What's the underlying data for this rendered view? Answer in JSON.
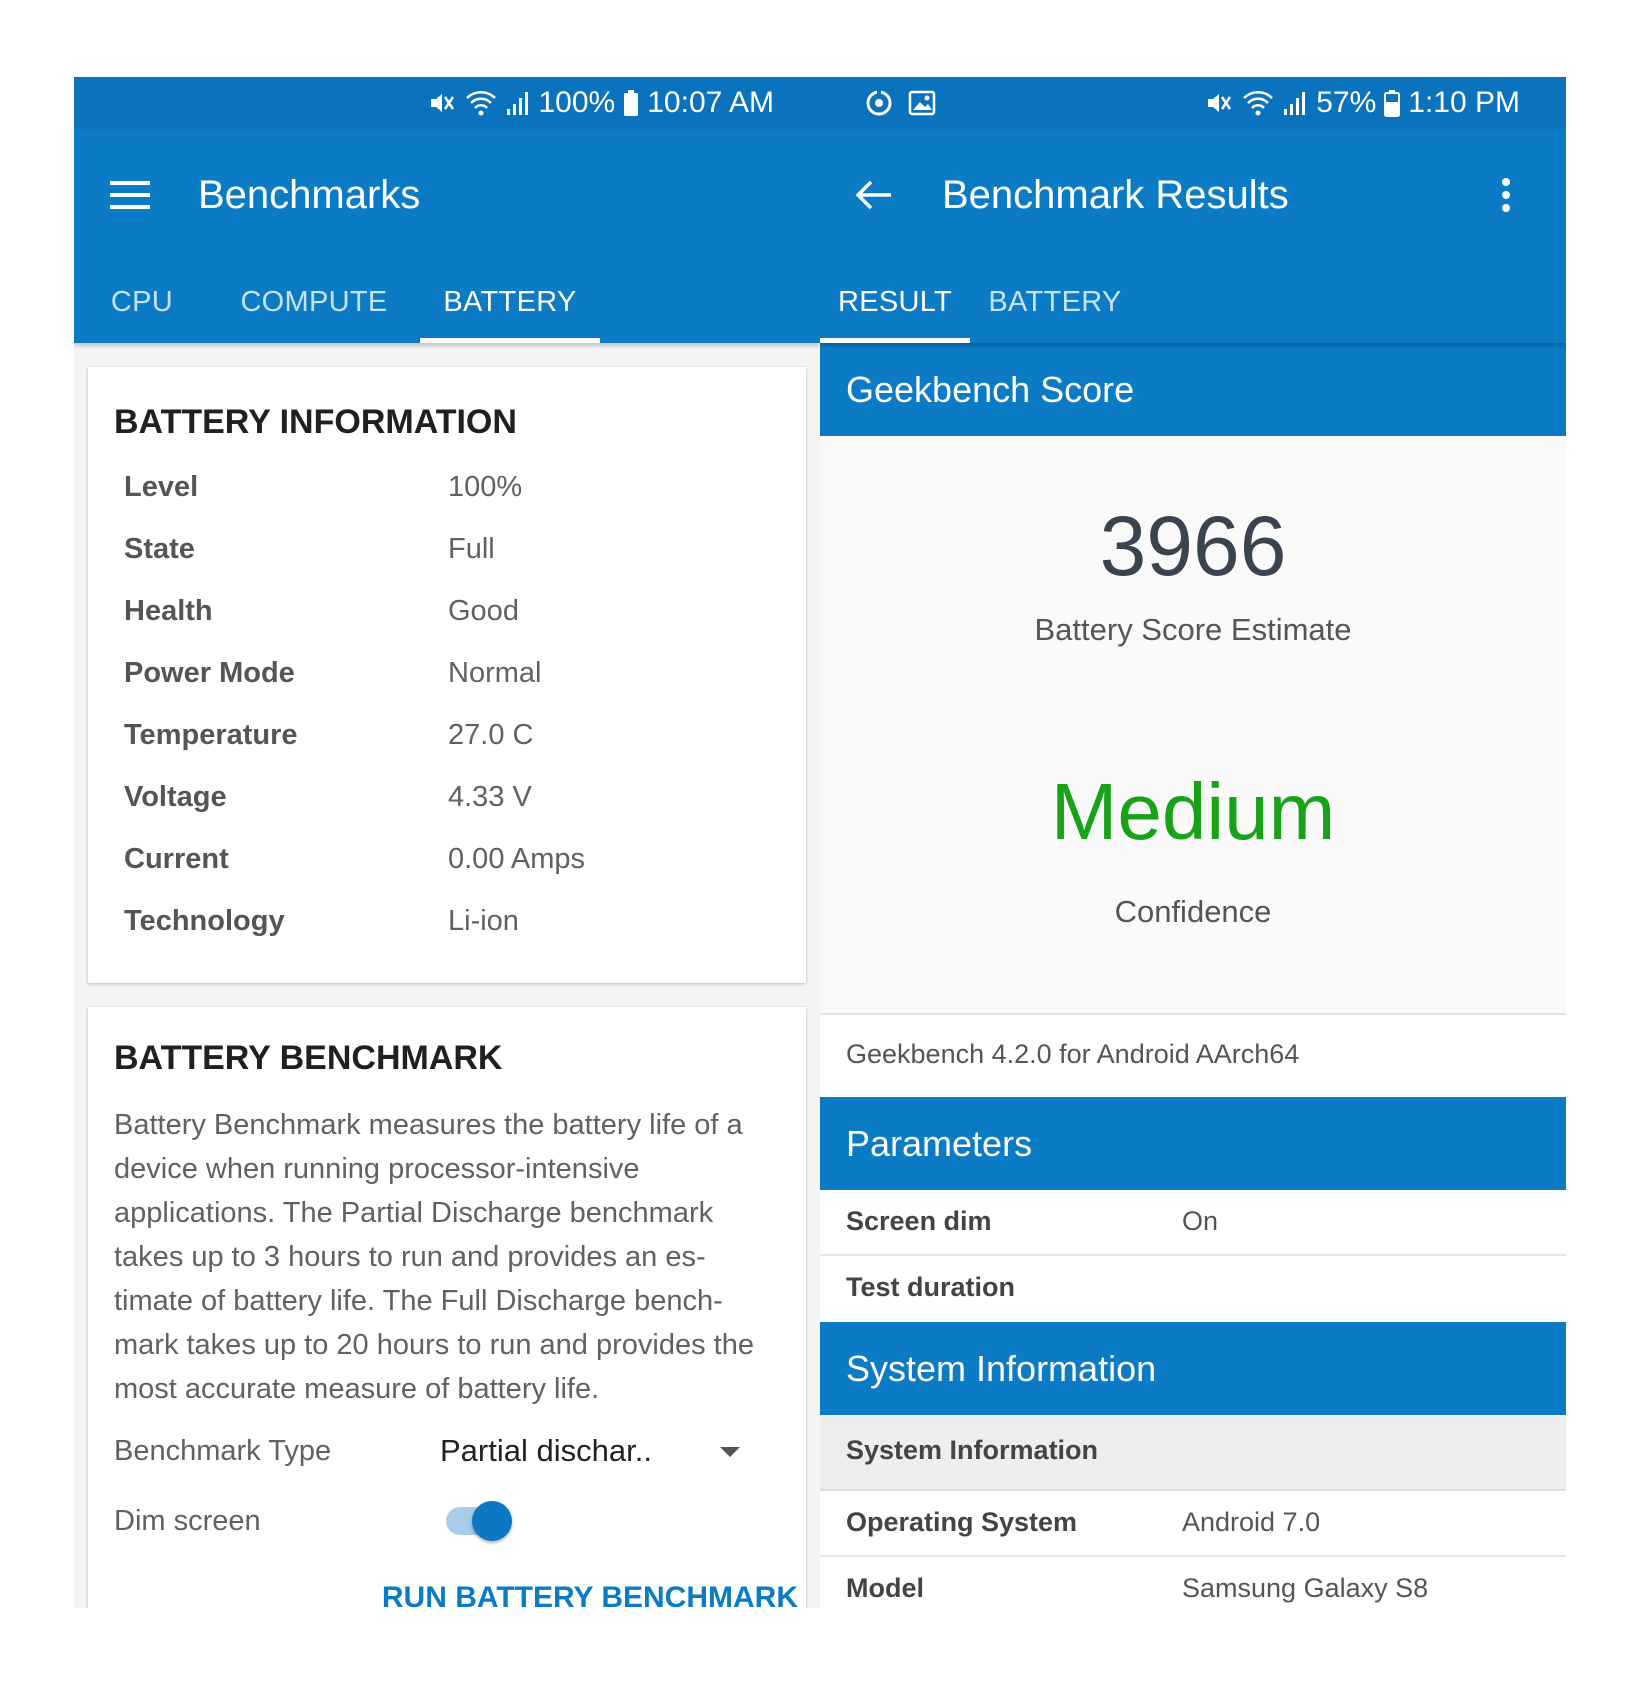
{
  "colors": {
    "primary": "#0b7bc6",
    "status_bar": "#0b72bd",
    "confidence": "#18a217"
  },
  "left": {
    "status": {
      "battery_percent": "100%",
      "time": "10:07 AM"
    },
    "app_title": "Benchmarks",
    "tabs": [
      {
        "label": "CPU",
        "active": false
      },
      {
        "label": "COMPUTE",
        "active": false
      },
      {
        "label": "BATTERY",
        "active": true
      }
    ],
    "battery_info": {
      "title": "BATTERY INFORMATION",
      "rows": [
        {
          "label": "Level",
          "value": "100%"
        },
        {
          "label": "State",
          "value": "Full"
        },
        {
          "label": "Health",
          "value": "Good"
        },
        {
          "label": "Power Mode",
          "value": "Normal"
        },
        {
          "label": "Temperature",
          "value": "27.0 C"
        },
        {
          "label": "Voltage",
          "value": "4.33 V"
        },
        {
          "label": "Current",
          "value": "0.00 Amps"
        },
        {
          "label": "Technology",
          "value": "Li-ion"
        }
      ]
    },
    "battery_benchmark": {
      "title": "BATTERY BENCHMARK",
      "description": "Battery Benchmark measures the battery life of a device when running processor-intensive applications. The Partial Discharge benchmark takes up to 3 hours to run and provides an es-timate of battery life. The Full Discharge bench-mark takes up to 20 hours to run and provides the most accurate measure of battery life.",
      "benchmark_type_label": "Benchmark Type",
      "benchmark_type_value": "Partial dischar..",
      "dim_screen_label": "Dim screen",
      "dim_screen_on": true,
      "run_button": "RUN BATTERY BENCHMARK"
    }
  },
  "right": {
    "status": {
      "battery_percent": "57%",
      "time": "1:10 PM"
    },
    "app_title": "Benchmark Results",
    "tabs": [
      {
        "label": "RESULT",
        "active": true
      },
      {
        "label": "BATTERY",
        "active": false
      }
    ],
    "score_header": "Geekbench Score",
    "score": "3966",
    "score_label": "Battery Score Estimate",
    "confidence": "Medium",
    "confidence_label": "Confidence",
    "version": "Geekbench 4.2.0 for Android AArch64",
    "parameters_header": "Parameters",
    "parameters": [
      {
        "key": "Screen dim",
        "value": "On"
      },
      {
        "key": "Test duration",
        "value": ""
      }
    ],
    "system_header": "System Information",
    "system_subheader": "System Information",
    "system_rows": [
      {
        "key": "Operating System",
        "value": "Android 7.0"
      },
      {
        "key": "Model",
        "value": "Samsung Galaxy S8"
      }
    ]
  }
}
